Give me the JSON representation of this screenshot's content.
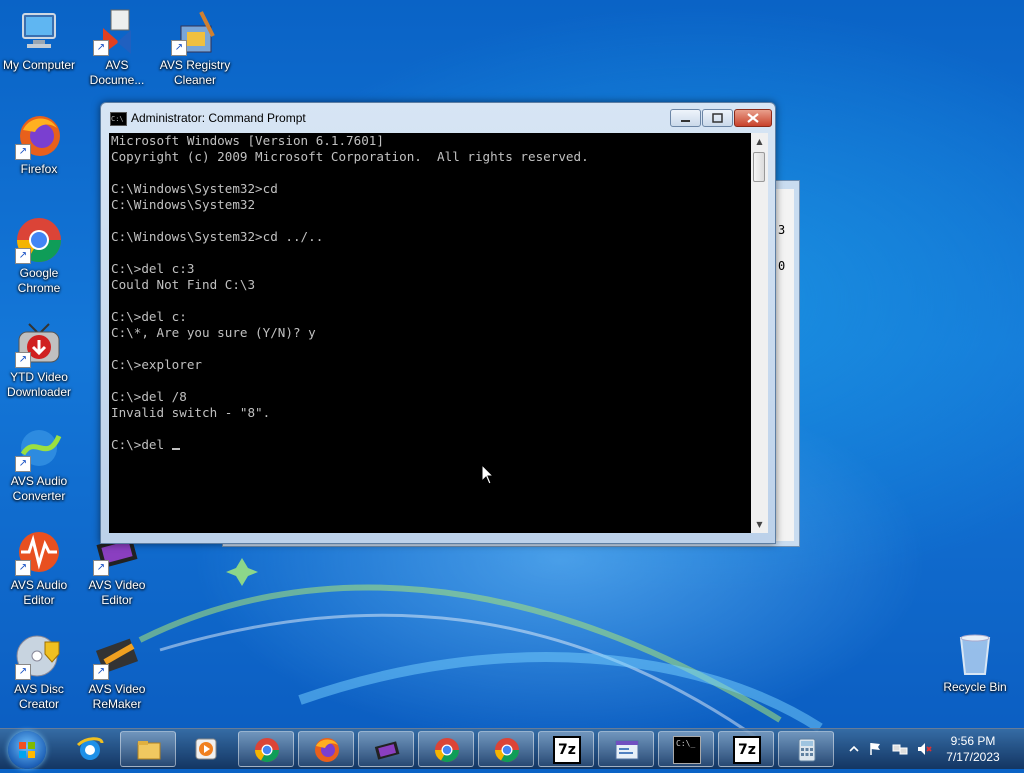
{
  "desktop": {
    "icons": [
      {
        "label": "My Computer"
      },
      {
        "label": "AVS Docume..."
      },
      {
        "label": "AVS Registry Cleaner"
      },
      {
        "label": "Firefox"
      },
      {
        "label": "Google Chrome"
      },
      {
        "label": "YTD Video Downloader"
      },
      {
        "label": "AVS Audio Converter"
      },
      {
        "label": "AVS Audio Editor"
      },
      {
        "label": "AVS Video Editor"
      },
      {
        "label": "AVS Disc Creator"
      },
      {
        "label": "AVS Video ReMaker"
      },
      {
        "label": "Recycle Bin"
      }
    ]
  },
  "background_window": {
    "fragment_1": "3",
    "fragment_2": "0"
  },
  "cmd": {
    "title": "Administrator: Command Prompt",
    "icon_text": "C:\\",
    "lines": [
      "Microsoft Windows [Version 6.1.7601]",
      "Copyright (c) 2009 Microsoft Corporation.  All rights reserved.",
      "",
      "C:\\Windows\\System32>cd",
      "C:\\Windows\\System32",
      "",
      "C:\\Windows\\System32>cd ../..",
      "",
      "C:\\>del c:3",
      "Could Not Find C:\\3",
      "",
      "C:\\>del c:",
      "C:\\*, Are you sure (Y/N)? y",
      "",
      "C:\\>explorer",
      "",
      "C:\\>del /8",
      "Invalid switch - \"8\".",
      ""
    ],
    "prompt_line": "C:\\>del "
  },
  "taskbar": {
    "items": [
      {
        "name": "internet-explorer"
      },
      {
        "name": "windows-explorer"
      },
      {
        "name": "media-player"
      },
      {
        "name": "google-chrome"
      },
      {
        "name": "firefox"
      },
      {
        "name": "avs-video-editor"
      },
      {
        "name": "google-chrome"
      },
      {
        "name": "google-chrome"
      },
      {
        "name": "7-zip",
        "text": "7z"
      },
      {
        "name": "control-panel-window"
      },
      {
        "name": "command-prompt",
        "text": "C:\\_"
      },
      {
        "name": "7-zip",
        "text": "7z"
      },
      {
        "name": "calculator"
      }
    ],
    "clock": {
      "time": "9:56 PM",
      "date": "7/17/2023"
    }
  },
  "colors": {
    "console_bg": "#000000",
    "console_fg": "#c0c0c0",
    "desktop_blue": "#1477d8"
  }
}
